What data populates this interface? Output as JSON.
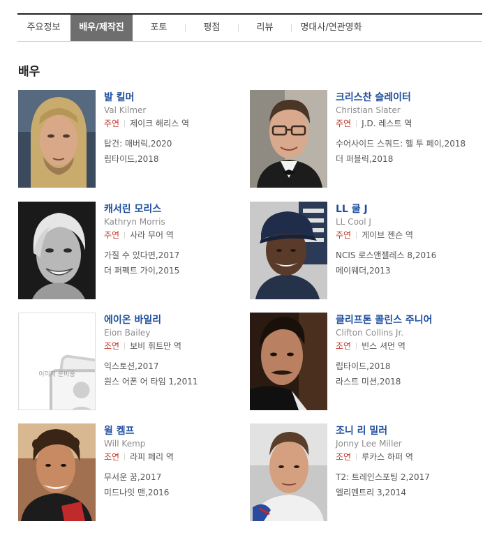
{
  "tabs": [
    {
      "label": "주요정보",
      "active": false
    },
    {
      "label": "배우/제작진",
      "active": true
    },
    {
      "label": "포토",
      "active": false
    },
    {
      "label": "평점",
      "active": false
    },
    {
      "label": "리뷰",
      "active": false
    },
    {
      "label": "명대사/연관영화",
      "active": false
    }
  ],
  "section_title": "배우",
  "actors": [
    {
      "name": "발 킬머",
      "eng": "Val Kilmer",
      "role_type": "주연",
      "role": "제이크 해리스 역",
      "works": [
        "탑건: 매버릭,2020",
        "립타이드,2018"
      ],
      "photo": "photo-long-hair-man"
    },
    {
      "name": "크리스찬 슬레이터",
      "eng": "Christian Slater",
      "role_type": "주연",
      "role": "J.D. 레스트 역",
      "works": [
        "수어사이드 스쿼드: 헬 투 페이,2018",
        "더 퍼블릭,2018"
      ],
      "photo": "photo-man-glasses-tuxedo"
    },
    {
      "name": "캐서린 모리스",
      "eng": "Kathryn Morris",
      "role_type": "주연",
      "role": "사라 무어 역",
      "works": [
        "가질 수 있다면,2017",
        "더 퍼펙트 가이,2015"
      ],
      "photo": "photo-woman-bw"
    },
    {
      "name": "LL 쿨 J",
      "eng": "LL Cool J",
      "role_type": "주연",
      "role": "게이브 젠슨 역",
      "works": [
        "NCIS 로스앤젤레스 8,2016",
        "메이웨더,2013"
      ],
      "photo": "photo-man-cap"
    },
    {
      "name": "에이온 바일리",
      "eng": "Eion Bailey",
      "role_type": "조연",
      "role": "보비 휘트만 역",
      "works": [
        "익스토션,2017",
        "원스 어폰 어 타임 1,2011"
      ],
      "photo": "placeholder",
      "placeholder_text": "이미지 준비중"
    },
    {
      "name": "클리프톤 콜린스 주니어",
      "eng": "Clifton Collins Jr.",
      "role_type": "조연",
      "role": "빈스 셔먼 역",
      "works": [
        "립타이드,2018",
        "라스트 미션,2018"
      ],
      "photo": "photo-man-mustache"
    },
    {
      "name": "윌 켐프",
      "eng": "Will Kemp",
      "role_type": "조연",
      "role": "라피 페리 역",
      "works": [
        "무서운 꿈,2017",
        "미드나잇 맨,2016"
      ],
      "photo": "photo-man-curly-hair"
    },
    {
      "name": "조니 리 밀러",
      "eng": "Jonny Lee Miller",
      "role_type": "조연",
      "role": "루카스 하퍼 역",
      "works": [
        "T2: 트레인스포팅 2,2017",
        "엘리멘트리 3,2014"
      ],
      "photo": "photo-man-short-hair"
    }
  ],
  "colors": {
    "name": "#1f4f9c",
    "role_type": "#c0392b",
    "active_tab": "#6e6e6e"
  }
}
